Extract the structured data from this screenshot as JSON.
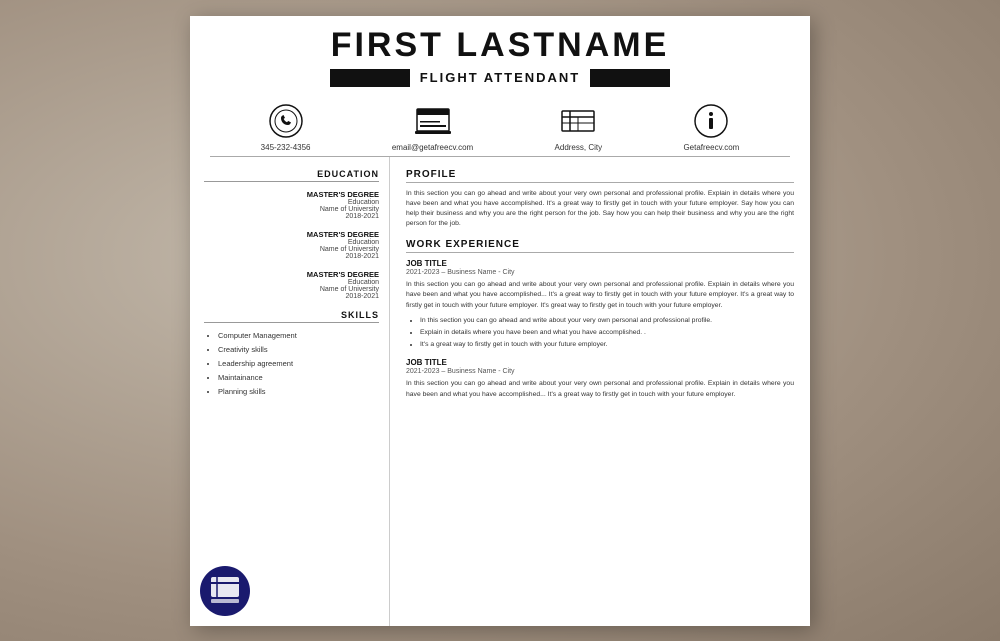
{
  "resume": {
    "name": "FIRST LASTNAME",
    "title": "FLIGHT ATTENDANT",
    "contact": {
      "phone": "345-232-4356",
      "email": "email@getafreecv.com",
      "address": "Address, City",
      "website": "Getafreecv.com"
    },
    "education": {
      "section_title": "EDUCATION",
      "entries": [
        {
          "degree": "MASTER'S DEGREE",
          "field": "Education",
          "university": "Name of University",
          "years": "2018-2021"
        },
        {
          "degree": "MASTER'S DEGREE",
          "field": "Education",
          "university": "Name of University",
          "years": "2018-2021"
        },
        {
          "degree": "MASTER'S DEGREE",
          "field": "Education",
          "university": "Name of University",
          "years": "2018-2021"
        }
      ]
    },
    "skills": {
      "section_title": "SKILLS",
      "items": [
        "Computer Management",
        "Creativity skills",
        "Leadership agreement",
        "Maintainance",
        "Planning skills"
      ]
    },
    "profile": {
      "section_title": "PROFILE",
      "text": "In this section you can go ahead and write about your very own personal and professional profile. Explain in details where you have been and what you have accomplished. It's a great way to firstly get in touch with your future employer. Say how you can help their business and why you are the right person for the job. Say how you can help their business and why you are the right person for the job."
    },
    "work_experience": {
      "section_title": "WORK EXPERIENCE",
      "jobs": [
        {
          "title": "JOB TITLE",
          "meta": "2021-2023 – Business Name - City",
          "description": "In this section you can go ahead and write about your very own personal and professional profile. Explain in details where you have been and what you have accomplished... It's a great way to firstly get in touch with your future employer. It's a great way to firstly get in touch with your future employer. It's great way to firstly get in touch with your future employer.",
          "bullets": [
            "In this section you can go ahead and write about your very own personal and professional profile.",
            "Explain in details where you have been and what you have accomplished. .",
            "It's a great way to firstly get in touch with your future employer."
          ]
        },
        {
          "title": "JOB TITLE",
          "meta": "2021-2023 – Business Name - City",
          "description": "In this section you can go ahead and write about your very own personal and professional profile. Explain in details where you have been and what you have accomplished... It's a great way to firstly get in touch with your future employer.",
          "bullets": []
        }
      ]
    }
  }
}
